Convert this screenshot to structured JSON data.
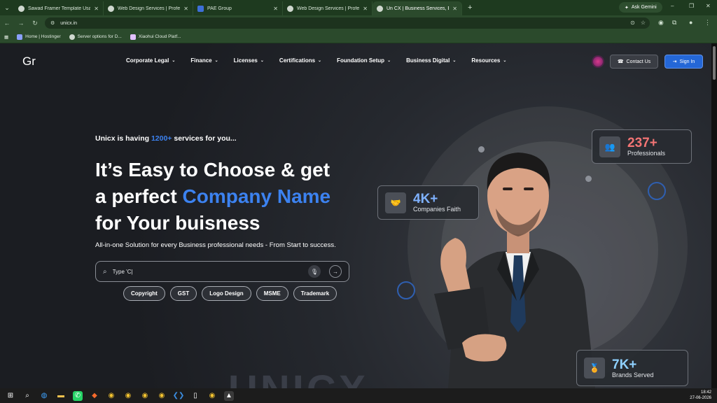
{
  "browser": {
    "tabs": [
      {
        "title": "Sawad Framer Template Usage",
        "active": false
      },
      {
        "title": "Web Design Services | Profess",
        "active": false
      },
      {
        "title": "PAE Group",
        "active": false
      },
      {
        "title": "Web Design Services | Profess",
        "active": false
      },
      {
        "title": "Un CX | Business Services, Expe",
        "active": true
      }
    ],
    "ask_gemini": "Ask Gemini",
    "url": "unicx.in",
    "bookmarks": [
      "Home | Hostinger",
      "Server options for D...",
      "Xiaohui Cloud Platf..."
    ]
  },
  "site": {
    "logo": "Gr",
    "nav": [
      "Corporate Legal",
      "Finance",
      "Licenses",
      "Certifications",
      "Foundation Setup",
      "Business Digital",
      "Resources"
    ],
    "contact_label": "Contact Us",
    "signin_label": "Sign In",
    "tagline_prefix": "Unicx is having ",
    "tagline_accent": "1200+",
    "tagline_suffix": " services for you...",
    "headline_1": "It’s Easy to Choose & get",
    "headline_2_prefix": "a perfect ",
    "headline_2_accent": "Company Name",
    "headline_3": "for Your buisness",
    "subline": "All-in-one Solution for every Business professional needs - From Start to success.",
    "search_value": "Type 'C|",
    "chips": [
      "Copyright",
      "GST",
      "Logo Design",
      "MSME",
      "Trademark"
    ],
    "stats": [
      {
        "value": "237+",
        "label": "Professionals",
        "color": "#f27474"
      },
      {
        "value": "4K+",
        "label": "Companies Faith",
        "color": "#7fb2ff"
      },
      {
        "value": "7K+",
        "label": "Brands Served",
        "color": "#8fd1ff"
      }
    ],
    "watermark": "UNICX"
  },
  "taskbar": {
    "time": "18:42",
    "date": "27-06-2026"
  },
  "colors": {
    "accent": "#3c82f0",
    "tab_bar": "#1e3a1f",
    "page_bg": "#1b1d22"
  }
}
